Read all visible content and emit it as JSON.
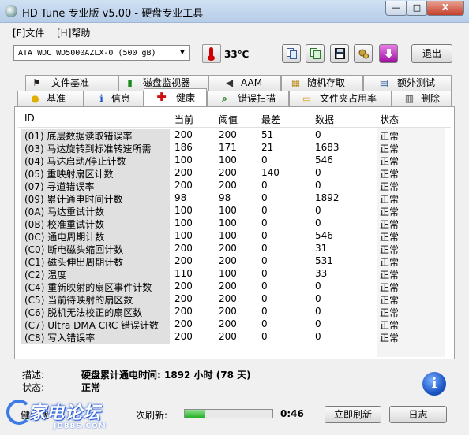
{
  "window": {
    "title": "HD Tune 专业版 v5.00 - 硬盘专业工具",
    "minimize": "—",
    "maximize": "□",
    "close": "X"
  },
  "menu": {
    "file": "[F]文件",
    "help": "[H]帮助"
  },
  "toolbar": {
    "drive": "ATA    WDC WD5000AZLX-0 (500 gB)",
    "temperature": "33℃",
    "exit": "退出"
  },
  "tabs_row1": [
    {
      "label": "文件基准",
      "icon": "file-benchmark-icon",
      "glyph": "⚑"
    },
    {
      "label": "磁盘监视器",
      "icon": "disk-monitor-icon",
      "glyph": "▮"
    },
    {
      "label": "AAM",
      "icon": "speaker-icon",
      "glyph": "◀"
    },
    {
      "label": "随机存取",
      "icon": "random-access-icon",
      "glyph": "▦"
    },
    {
      "label": "额外测试",
      "icon": "extra-tests-icon",
      "glyph": "▤"
    }
  ],
  "tabs_row2": [
    {
      "label": "基准",
      "icon": "benchmark-icon",
      "glyph": "●"
    },
    {
      "label": "信息",
      "icon": "info-icon",
      "glyph": "i"
    },
    {
      "label": "健康",
      "icon": "health-cross-icon",
      "glyph": "✚"
    },
    {
      "label": "错误扫描",
      "icon": "magnifier-icon",
      "glyph": "⌕"
    },
    {
      "label": "文件夹占用率",
      "icon": "folder-icon",
      "glyph": "▭"
    },
    {
      "label": "删除",
      "icon": "trash-icon",
      "glyph": "▥"
    }
  ],
  "table": {
    "headers": [
      "ID",
      "当前",
      "阈值",
      "最差",
      "数据",
      "状态"
    ],
    "rows": [
      [
        "(01) 底层数据读取错误率",
        "200",
        "200",
        "51",
        "0",
        "正常"
      ],
      [
        "(03) 马达旋转到标准转速所需",
        "186",
        "171",
        "21",
        "1683",
        "正常"
      ],
      [
        "(04) 马达启动/停止计数",
        "100",
        "100",
        "0",
        "546",
        "正常"
      ],
      [
        "(05) 重映射扇区计数",
        "200",
        "200",
        "140",
        "0",
        "正常"
      ],
      [
        "(07) 寻道错误率",
        "200",
        "200",
        "0",
        "0",
        "正常"
      ],
      [
        "(09) 累计通电时间计数",
        "98",
        "98",
        "0",
        "1892",
        "正常"
      ],
      [
        "(0A) 马达重试计数",
        "100",
        "100",
        "0",
        "0",
        "正常"
      ],
      [
        "(0B) 校准重试计数",
        "100",
        "100",
        "0",
        "0",
        "正常"
      ],
      [
        "(0C) 通电周期计数",
        "100",
        "100",
        "0",
        "546",
        "正常"
      ],
      [
        "(C0) 断电磁头缩回计数",
        "200",
        "200",
        "0",
        "31",
        "正常"
      ],
      [
        "(C1) 磁头伸出周期计数",
        "200",
        "200",
        "0",
        "531",
        "正常"
      ],
      [
        "(C2) 温度",
        "110",
        "100",
        "0",
        "33",
        "正常"
      ],
      [
        "(C4) 重新映射的扇区事件计数",
        "200",
        "200",
        "0",
        "0",
        "正常"
      ],
      [
        "(C5) 当前待映射的扇区数",
        "200",
        "200",
        "0",
        "0",
        "正常"
      ],
      [
        "(C6) 脱机无法校正的扇区数",
        "200",
        "200",
        "0",
        "0",
        "正常"
      ],
      [
        "(C7) Ultra DMA CRC 错误计数",
        "200",
        "200",
        "0",
        "0",
        "正常"
      ],
      [
        "(C8) 写入错误率",
        "200",
        "200",
        "0",
        "0",
        "正常"
      ]
    ]
  },
  "details": {
    "desc_label": "描述:",
    "desc_value": "硬盘累计通电时间: 1892 小时 (78 天)",
    "status_label": "状态:",
    "status_value": "正常"
  },
  "footer": {
    "health_label": "健康状",
    "refresh_label": "次刷新:",
    "progress_fraction": 0.23,
    "countdown": "0:46",
    "refresh_button": "立即刷新",
    "log_button": "日志"
  },
  "watermark": {
    "text": "家电论坛",
    "url": "JDBBS.COM"
  },
  "colors": {
    "health_cross": "#d01010",
    "exit_purple": "#c020c0",
    "progress_green": "#24b024"
  }
}
